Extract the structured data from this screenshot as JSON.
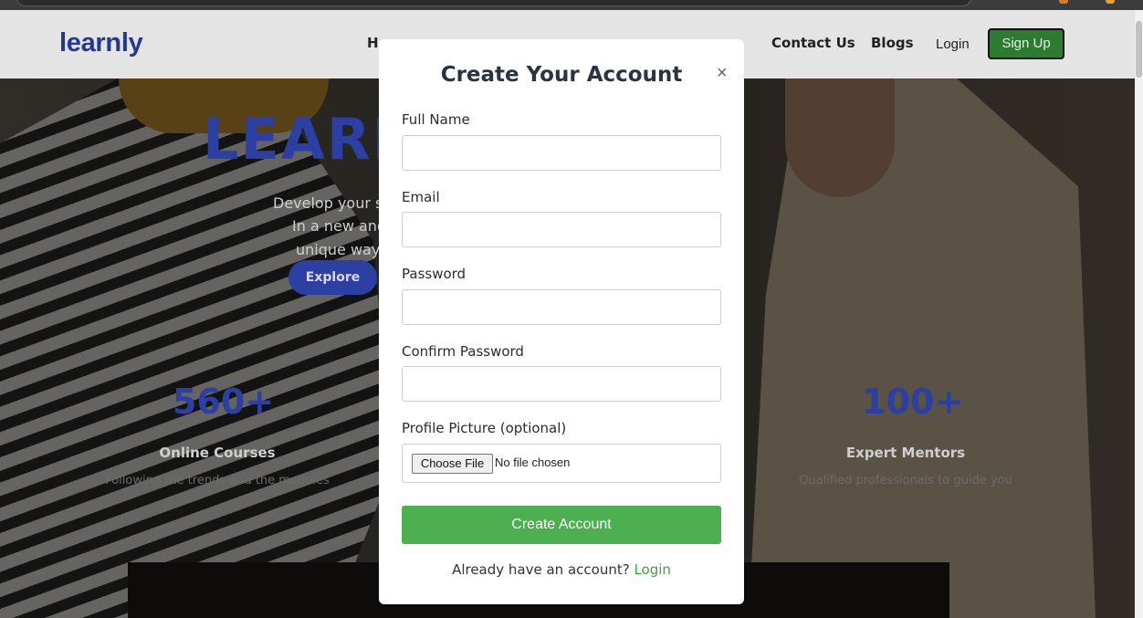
{
  "navbar": {
    "brand": "learnly",
    "links": [
      "H",
      "Contact Us",
      "Blogs"
    ],
    "login": "Login",
    "signup": "Sign Up"
  },
  "hero": {
    "title": "LEARN",
    "subtitle_lines": [
      "Develop your ski",
      "In a new and",
      "unique way"
    ],
    "explore": "Explore",
    "stats": [
      {
        "number": "560+",
        "label": "Online Courses",
        "desc": "Following the trends and the modules"
      },
      {
        "number": "100+",
        "label": "Expert Mentors",
        "desc": "Qualified professionals to guide you"
      }
    ]
  },
  "modal": {
    "title": "Create Your Account",
    "close": "×",
    "fields": [
      {
        "label": "Full Name",
        "value": ""
      },
      {
        "label": "Email",
        "value": ""
      },
      {
        "label": "Password",
        "value": ""
      },
      {
        "label": "Confirm Password",
        "value": ""
      }
    ],
    "profile_label": "Profile Picture (optional)",
    "choose_file": "Choose File",
    "no_file": "No file chosen",
    "submit": "Create Account",
    "footer_text": "Already have an account?",
    "footer_link": "Login"
  },
  "colors": {
    "brand": "#243a9a",
    "accent_green": "#4caf50",
    "signup_green": "#2e7d32"
  }
}
